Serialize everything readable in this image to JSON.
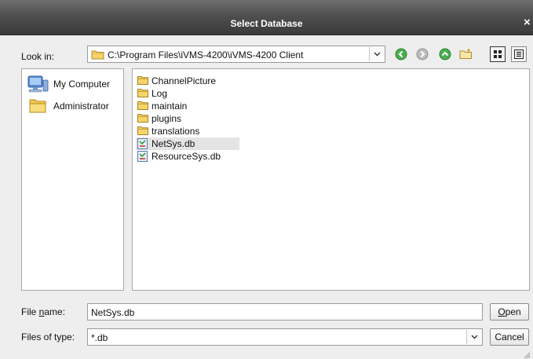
{
  "window": {
    "title": "Select Database",
    "close_glyph": "×"
  },
  "lookin": {
    "label": "Look in:",
    "path": "C:\\Program Files\\iVMS-4200\\iVMS-4200 Client",
    "dropdown_icon": "chevron-down-icon"
  },
  "toolbar": {
    "buttons": [
      {
        "name": "back",
        "icon": "arrow-left-circle-icon",
        "color": "#4caf50"
      },
      {
        "name": "forward",
        "icon": "arrow-right-circle-icon",
        "color": "#9e9e9e"
      },
      {
        "name": "up",
        "icon": "arrow-up-circle-icon",
        "color": "#4caf50"
      },
      {
        "name": "new-folder",
        "icon": "new-folder-icon"
      },
      {
        "name": "list-view",
        "icon": "list-view-icon"
      },
      {
        "name": "detail-view",
        "icon": "detail-view-icon"
      }
    ]
  },
  "places": [
    {
      "label": "My Computer",
      "icon": "computer-icon"
    },
    {
      "label": "Administrator",
      "icon": "folder-icon"
    }
  ],
  "files": [
    {
      "name": "ChannelPicture",
      "type": "folder",
      "icon": "folder-icon"
    },
    {
      "name": "Log",
      "type": "folder",
      "icon": "folder-icon"
    },
    {
      "name": "maintain",
      "type": "folder",
      "icon": "folder-icon"
    },
    {
      "name": "plugins",
      "type": "folder",
      "icon": "folder-icon"
    },
    {
      "name": "translations",
      "type": "folder",
      "icon": "folder-icon"
    },
    {
      "name": "NetSys.db",
      "type": "file",
      "icon": "db-file-icon",
      "selected": true
    },
    {
      "name": "ResourceSys.db",
      "type": "file",
      "icon": "db-file-icon"
    }
  ],
  "filename": {
    "label_pre": "File ",
    "label_accel": "n",
    "label_post": "ame:",
    "value": "NetSys.db"
  },
  "filetype": {
    "label": "Files of type:",
    "value": "*.db"
  },
  "buttons": {
    "open_accel": "O",
    "open_rest": "pen",
    "cancel": "Cancel"
  },
  "colors": {
    "title_bg": "#4a4a4a",
    "dialog_bg": "#eeeeee",
    "selection": "#e4e4e4"
  }
}
